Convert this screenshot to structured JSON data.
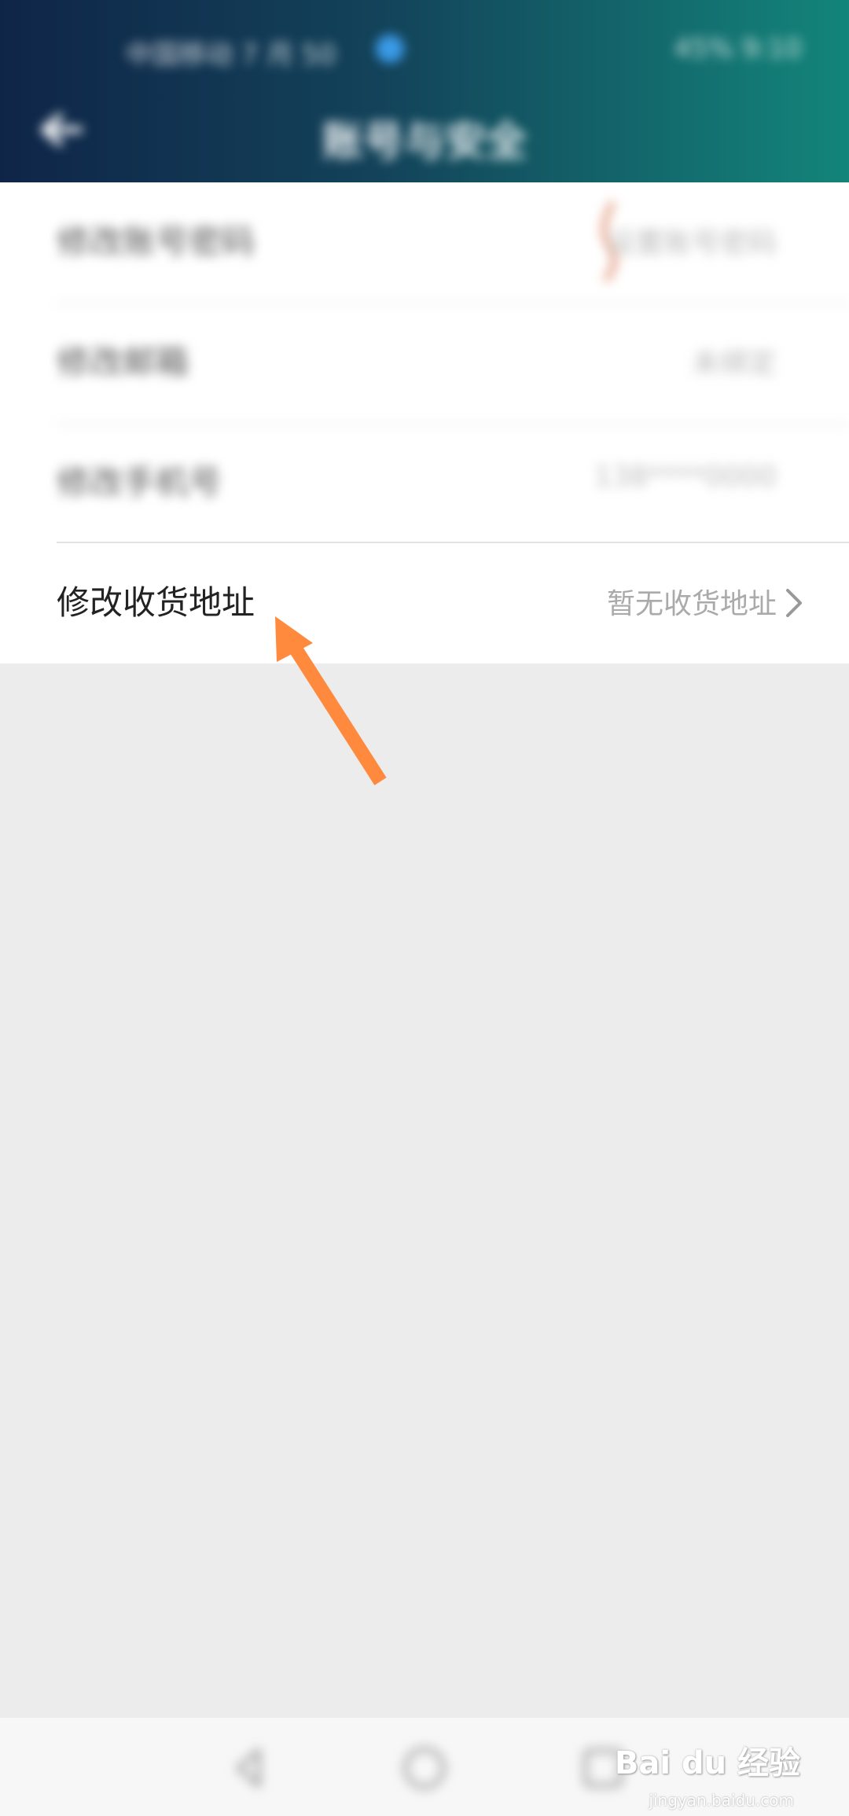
{
  "status_bar": {
    "left_text": "中国移动 7 月 50",
    "right_text": "45% 9:10"
  },
  "header": {
    "title": "账号与安全"
  },
  "rows": [
    {
      "label": "修改账号密码",
      "value": "设置账号密码"
    },
    {
      "label": "修改邮箱",
      "value": "未绑定"
    },
    {
      "label": "修改手机号",
      "value": "138****0000"
    },
    {
      "label": "修改收货地址",
      "value": "暂无收货地址"
    }
  ],
  "watermark": {
    "brand": "Bai du 经验",
    "url": "jingyan.baidu.com"
  },
  "colors": {
    "header_start": "#0f2548",
    "header_end": "#13857a",
    "arrow": "#ff8a3d",
    "page_bg": "#ebeceb"
  }
}
